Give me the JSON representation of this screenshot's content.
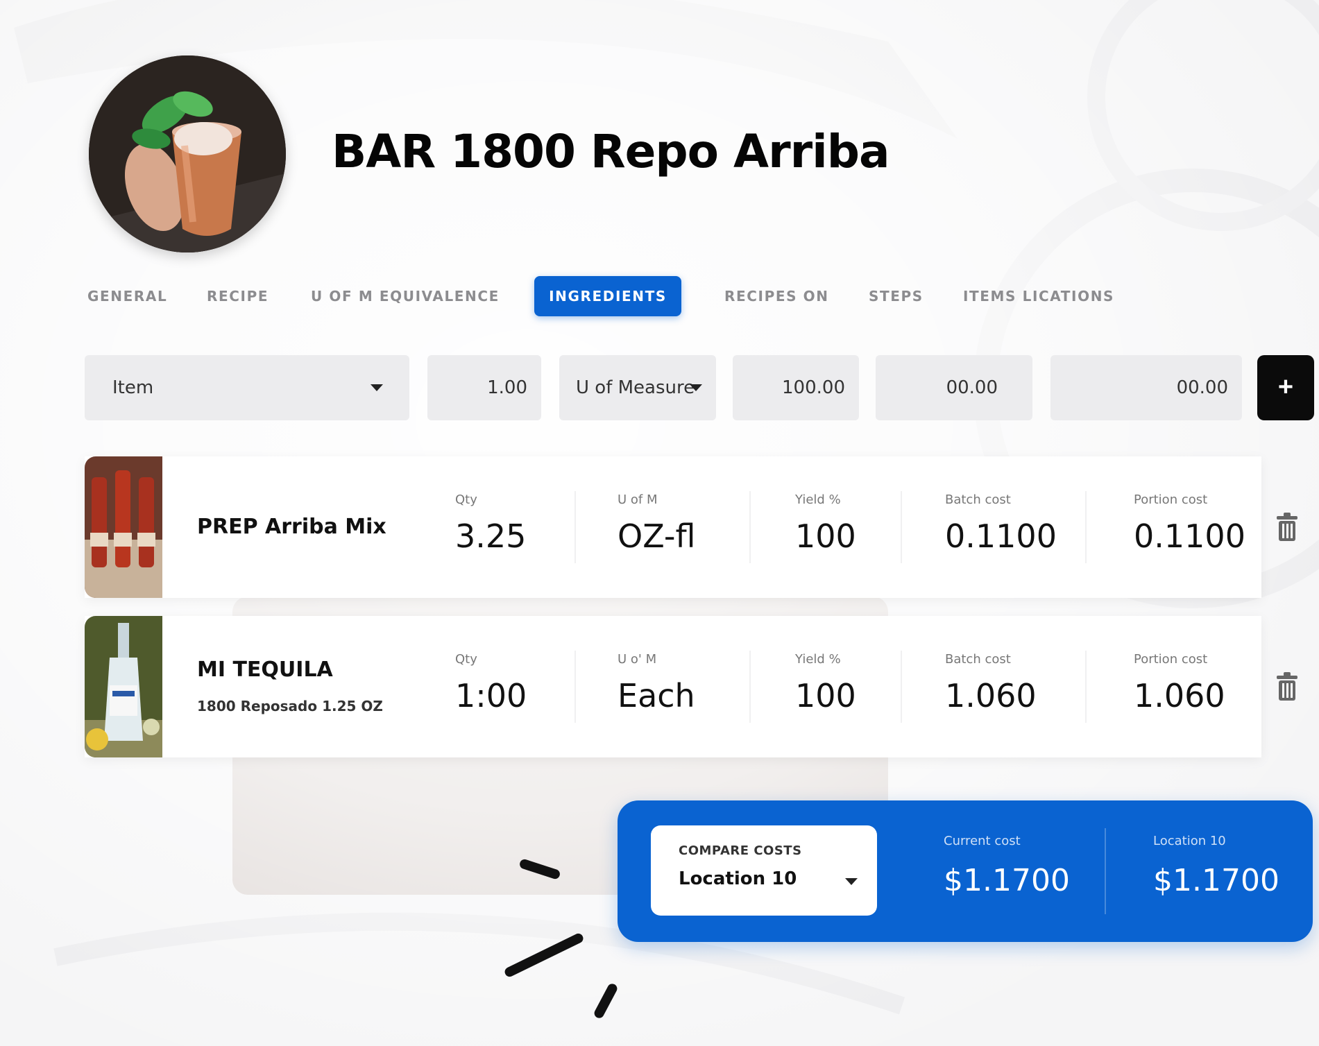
{
  "recipe": {
    "title": "BAR 1800 Repo Arriba"
  },
  "tabs": [
    {
      "label": "GENERAL",
      "active": false
    },
    {
      "label": "RECIPE",
      "active": false
    },
    {
      "label": "U OF M EQUIVALENCE",
      "active": false
    },
    {
      "label": "INGREDIENTS",
      "active": true
    },
    {
      "label": "RECIPES ON",
      "active": false
    },
    {
      "label": "STEPS",
      "active": false
    },
    {
      "label": "ITEMS LICATIONS",
      "active": false
    }
  ],
  "add_row": {
    "item_label": "Item",
    "qty": "1.00",
    "uom_label": "U of Measure",
    "yield": "100.00",
    "batch_cost": "00.00",
    "portion_cost": "00.00",
    "add_button": "+"
  },
  "ingredients": [
    {
      "name": "PREP Arriba Mix",
      "description": "",
      "qty_label": "Qty",
      "qty": "3.25",
      "uom_label": "U of M",
      "uom": "OZ-fl",
      "yield_label": "Yield %",
      "yield": "100",
      "batch_label": "Batch cost",
      "batch_cost": "0.1100",
      "portion_label": "Portion cost",
      "portion_cost": "0.1100"
    },
    {
      "name": "MI TEQUILA",
      "description": "1800 Reposado 1.25 OZ",
      "qty_label": "Qty",
      "qty": "1:00",
      "uom_label": "U o' M",
      "uom": "Each",
      "yield_label": "Yield %",
      "yield": "100",
      "batch_label": "Batch cost",
      "batch_cost": "1.060",
      "portion_label": "Portion cost",
      "portion_cost": "1.060"
    }
  ],
  "compare": {
    "label": "COMPARE COSTS",
    "selected": "Location 10",
    "current_cost_label": "Current cost",
    "current_cost": "$1.1700",
    "location_cost_label": "Location 10",
    "location_cost": "$1.1700"
  },
  "colors": {
    "accent": "#0a63d1",
    "dark_button": "#0b0b0b"
  }
}
